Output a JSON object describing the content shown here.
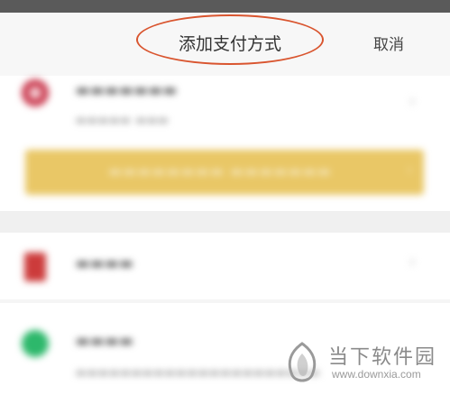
{
  "header": {
    "title": "添加支付方式",
    "cancel_label": "取消"
  },
  "watermark": {
    "name": "当下软件园",
    "url": "www.downxia.com"
  },
  "colors": {
    "annotation_circle": "#d9552f",
    "promo_banner": "#e9c766"
  }
}
